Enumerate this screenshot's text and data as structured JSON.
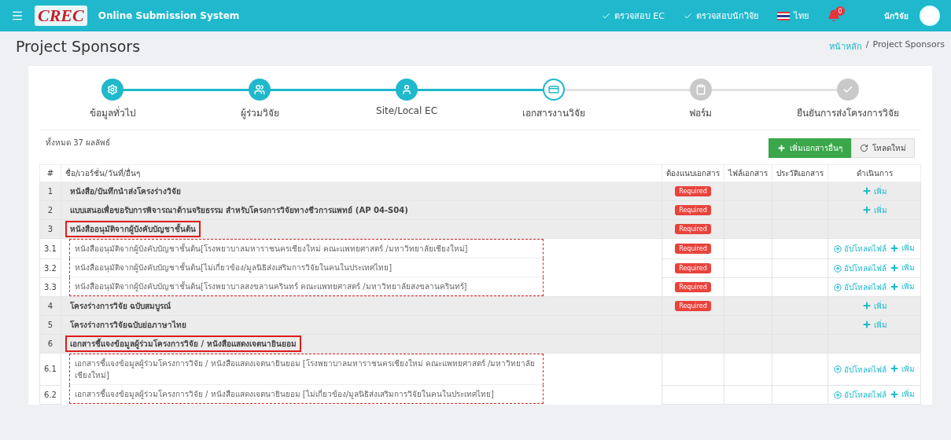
{
  "header": {
    "logo": "CREC",
    "app_title": "Online Submission System",
    "checks": [
      {
        "label": "ตรวจสอบ EC"
      },
      {
        "label": "ตรวจสอบนักวิจัย"
      }
    ],
    "language": "ไทย",
    "notification_count": "0",
    "user_role": "นักวิจัย"
  },
  "page": {
    "title": "Project Sponsors",
    "breadcrumb_separator": "/",
    "breadcrumb": [
      {
        "label": "หน้าหลัก",
        "selected": false
      },
      {
        "label": "Project Sponsors",
        "selected": true
      }
    ]
  },
  "steps": [
    {
      "label": "ข้อมูลทั่วไป",
      "completed": true,
      "selected": false
    },
    {
      "label": "ผู้ร่วมวิจัย",
      "completed": true,
      "selected": false
    },
    {
      "label": "Site/Local EC",
      "completed": true,
      "selected": false
    },
    {
      "label": "เอกสารงานวิจัย",
      "completed": false,
      "selected": true
    },
    {
      "label": "ฟอร์ม",
      "completed": false,
      "selected": false
    },
    {
      "label": "ยืนยันการส่งโครงการวิจัย",
      "completed": false,
      "selected": false
    }
  ],
  "summary": "ทั้งหมด 37 ผลลัพธ์",
  "buttons": [
    {
      "label": "เพิ่มเอกสารอื่นๆ",
      "kind": "add"
    },
    {
      "label": "โหลดใหม่",
      "kind": "reload"
    }
  ],
  "table": {
    "columns": [
      "#",
      "ชื่อ/เวอร์ชั่น/วันที่/อื่นๆ",
      "ต้องแนบเอกสาร",
      "ไฟล์เอกสาร",
      "ประวัติเอกสาร",
      "ดำเนินการ"
    ],
    "rows": [
      {
        "number": "1",
        "name": "หนังสือ/บันทึกนำส่งโครงร่างวิจัย",
        "badge": "Required",
        "highlighted": false,
        "actions": [
          {
            "kind": "add",
            "label": "เพิ่ม"
          }
        ]
      },
      {
        "number": "2",
        "name": "แบบเสนอเพื่อขอรับการพิจารณาด้านจริยธรรม สำหรับโครงการวิจัยทางชีวการแพทย์ (AP 04-S04)",
        "badge": "Required",
        "highlighted": false,
        "actions": [
          {
            "kind": "add",
            "label": "เพิ่ม"
          }
        ]
      },
      {
        "number": "3",
        "name": "หนังสืออนุมัติจากผู้บังคับบัญชาชั้นต้น",
        "badge": "Required",
        "highlighted": true,
        "actions": [],
        "children": [
          {
            "number": "3.1",
            "name": "หนังสืออนุมัติจากผู้บังคับบัญชาชั้นต้น[โรงพยาบาลมหาราชนครเชียงใหม่ คณะแพทยศาสตร์ /มหาวิทยาลัยเชียงใหม่]",
            "badge": "Required",
            "actions": [
              {
                "kind": "upload",
                "label": "อัปโหลดไฟล์"
              },
              {
                "kind": "add",
                "label": "เพิ่ม"
              }
            ]
          },
          {
            "number": "3.2",
            "name": "หนังสืออนุมัติจากผู้บังคับบัญชาชั้นต้น[ไม่เกี่ยวข้อง/มูลนิธิส่งเสริมการวิจัยในคนในประเทศไทย]",
            "badge": "Required",
            "actions": [
              {
                "kind": "upload",
                "label": "อัปโหลดไฟล์"
              },
              {
                "kind": "add",
                "label": "เพิ่ม"
              }
            ]
          },
          {
            "number": "3.3",
            "name": "หนังสืออนุมัติจากผู้บังคับบัญชาชั้นต้น[โรงพยาบาลสงขลานครินทร์ คณะแพทยศาสตร์ /มหาวิทยาลัยสงขลานครินทร์]",
            "badge": "Required",
            "actions": [
              {
                "kind": "upload",
                "label": "อัปโหลดไฟล์"
              },
              {
                "kind": "add",
                "label": "เพิ่ม"
              }
            ]
          }
        ]
      },
      {
        "number": "4",
        "name": "โครงร่างการวิจัย ฉบับสมบูรณ์",
        "badge": "Required",
        "highlighted": false,
        "actions": [
          {
            "kind": "add",
            "label": "เพิ่ม"
          }
        ]
      },
      {
        "number": "5",
        "name": "โครงร่างการวิจัยฉบับย่อภาษาไทย",
        "highlighted": false,
        "actions": [
          {
            "kind": "add",
            "label": "เพิ่ม"
          }
        ]
      },
      {
        "number": "6",
        "name": "เอกสารชี้แจงข้อมูลผู้ร่วมโครงการวิจัย / หนังสือแสดงเจตนายินยอม",
        "highlighted": true,
        "actions": [],
        "children": [
          {
            "number": "6.1",
            "name": "เอกสารชี้แจงข้อมูลผู้ร่วมโครงการวิจัย / หนังสือแสดงเจตนายินยอม [โรงพยาบาลมหาราชนครเชียงใหม่ คณะแพทยศาสตร์ /มหาวิทยาลัยเชียงใหม่]",
            "actions": [
              {
                "kind": "upload",
                "label": "อัปโหลดไฟล์"
              },
              {
                "kind": "add",
                "label": "เพิ่ม"
              }
            ]
          },
          {
            "number": "6.2",
            "name": "เอกสารชี้แจงข้อมูลผู้ร่วมโครงการวิจัย / หนังสือแสดงเจตนายินยอม [ไม่เกี่ยวข้อง/มูลนิธิส่งเสริมการวิจัยในคนในประเทศไทย]",
            "actions": [
              {
                "kind": "upload",
                "label": "อัปโหลดไฟล์"
              },
              {
                "kind": "add",
                "label": "เพิ่ม"
              }
            ]
          }
        ]
      }
    ]
  }
}
